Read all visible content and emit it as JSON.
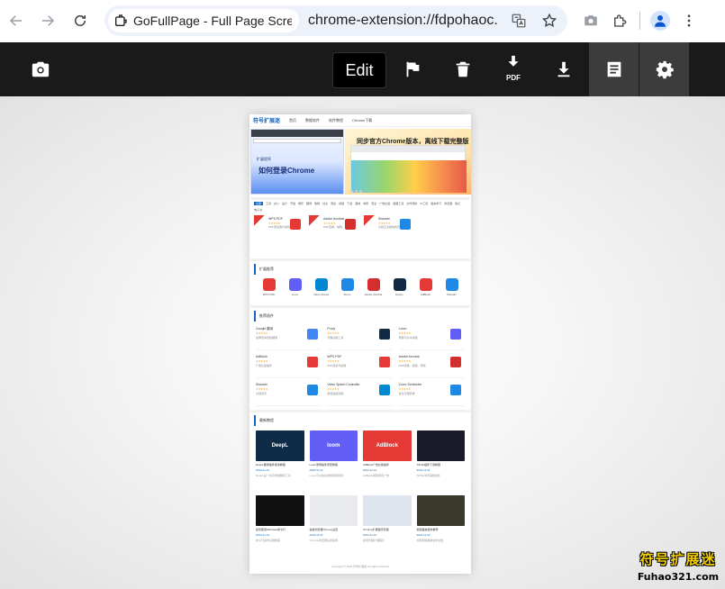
{
  "browser": {
    "tab_chip_title": "GoFullPage - Full Page Screen C",
    "url": "chrome-extension://fdpohaoc..."
  },
  "toolbar": {
    "edit_label": "Edit",
    "pdf_label": "PDF"
  },
  "page_preview": {
    "logo": "符号扩展迷",
    "nav": [
      "首页",
      "数据软件",
      "软件教程",
      "Chrome下载"
    ],
    "banner_left_sub": "扩展程序",
    "banner_left_title": "如何登录Chrome",
    "banner_right_title": "同步官方Chrome版本，离线下载完整版",
    "tags": [
      "全部",
      "工具",
      "办公",
      "设计",
      "开发",
      "娱乐",
      "翻译",
      "购物",
      "社交",
      "阅读",
      "视频",
      "下载",
      "其他",
      "效率",
      "安全",
      "广告拦截",
      "截图工具",
      "文件转换",
      "AI工具",
      "语言学习",
      "浏览器",
      "笔记",
      "电子书"
    ],
    "top_apps": [
      {
        "name": "WPS PDF",
        "stars": "★★★★★",
        "desc": "PDF阅读器与编辑工具",
        "color": "#e53935"
      },
      {
        "name": "Adobe Acrobat",
        "stars": "★★★★★",
        "desc": "PDF查看、编辑、转换",
        "color": "#d32f2f"
      },
      {
        "name": "Shazam",
        "stars": "★★★★★",
        "desc": "识别正在播放的音乐",
        "color": "#1e88e5"
      }
    ],
    "section2_title": "扩展推荐",
    "featured_icons": [
      {
        "label": "WPS PDF",
        "color": "#e53935"
      },
      {
        "label": "Loom",
        "color": "#625df5"
      },
      {
        "label": "Video Speed",
        "color": "#0288d1"
      },
      {
        "label": "Zoom",
        "color": "#1e88e5"
      },
      {
        "label": "Adobe Acrobat",
        "color": "#d32f2f"
      },
      {
        "label": "DeepL",
        "color": "#0f2b46"
      },
      {
        "label": "AdBlock",
        "color": "#e53935"
      },
      {
        "label": "Shazam",
        "color": "#1e88e5"
      }
    ],
    "section3_title": "推荐插件",
    "grid_apps": [
      {
        "name": "Google 翻译",
        "stars": "★★★★★",
        "desc": "在网页中轻松翻译",
        "color": "#4285f4"
      },
      {
        "name": "Proxy",
        "stars": "★★★★★",
        "desc": "代理切换工具",
        "color": "#0f2b46"
      },
      {
        "name": "Loom",
        "stars": "★★★★★",
        "desc": "录屏与共享视频",
        "color": "#625df5"
      },
      {
        "name": "AdBlock",
        "stars": "★★★★★",
        "desc": "广告拦截插件",
        "color": "#e53935"
      },
      {
        "name": "WPS PDF",
        "stars": "★★★★★",
        "desc": "PDF阅读与编辑",
        "color": "#e53935"
      },
      {
        "name": "Adobe Acrobat",
        "stars": "★★★★★",
        "desc": "PDF查看、编辑、转换",
        "color": "#d32f2f"
      },
      {
        "name": "Shazam",
        "stars": "★★★★★",
        "desc": "识别音乐",
        "color": "#1e88e5"
      },
      {
        "name": "Video Speed Controller",
        "stars": "★★★★★",
        "desc": "视频速度控制",
        "color": "#0288d1"
      },
      {
        "name": "Zoom Scheduler",
        "stars": "★★★★★",
        "desc": "会议日程安排",
        "color": "#1e88e5"
      }
    ],
    "section4_title": "最新教程",
    "articles": [
      {
        "title": "DeepL翻译插件使用教程",
        "date": "2024-11-01",
        "img_text": "DeepL",
        "color": "#0f2b46",
        "excerpt": "DeepL是一款高质量翻译工具"
      },
      {
        "title": "Loom录屏插件安装教程",
        "date": "2024-11-01",
        "img_text": "loom",
        "color": "#625df5",
        "excerpt": "Loom可以快速录制屏幕视频"
      },
      {
        "title": "AdBlock广告拦截插件",
        "date": "2024-11-01",
        "img_text": "AdBlock",
        "color": "#e53935",
        "excerpt": "AdBlock屏蔽网页广告"
      },
      {
        "title": "TikTok插件下载教程",
        "date": "2024-11-01",
        "img_text": "",
        "color": "#1b1b2a",
        "excerpt": "TikTok浏览辅助插件"
      },
      {
        "title": "如何使用Windows命令行",
        "date": "2024-11-01",
        "img_text": "",
        "color": "#111111",
        "excerpt": "命令行操作基础教程"
      },
      {
        "title": "谷歌浏览器Chrome设置",
        "date": "2024-11-01",
        "img_text": "",
        "color": "#e8eaed",
        "excerpt": "Chrome浏览器设置指南"
      },
      {
        "title": "Chrome扩展程序管理",
        "date": "2024-11-01",
        "img_text": "",
        "color": "#dfe5ee",
        "excerpt": "如何管理扩展程序"
      },
      {
        "title": "视频播放插件推荐",
        "date": "2024-11-01",
        "img_text": "",
        "color": "#3a3a2a",
        "excerpt": "常用视频播放插件合集"
      }
    ],
    "footer": "Copyright © 2024 符号扩展迷 All rights reserved"
  },
  "watermark": {
    "cn": "符号扩展迷",
    "en": "Fuhao321.com"
  }
}
